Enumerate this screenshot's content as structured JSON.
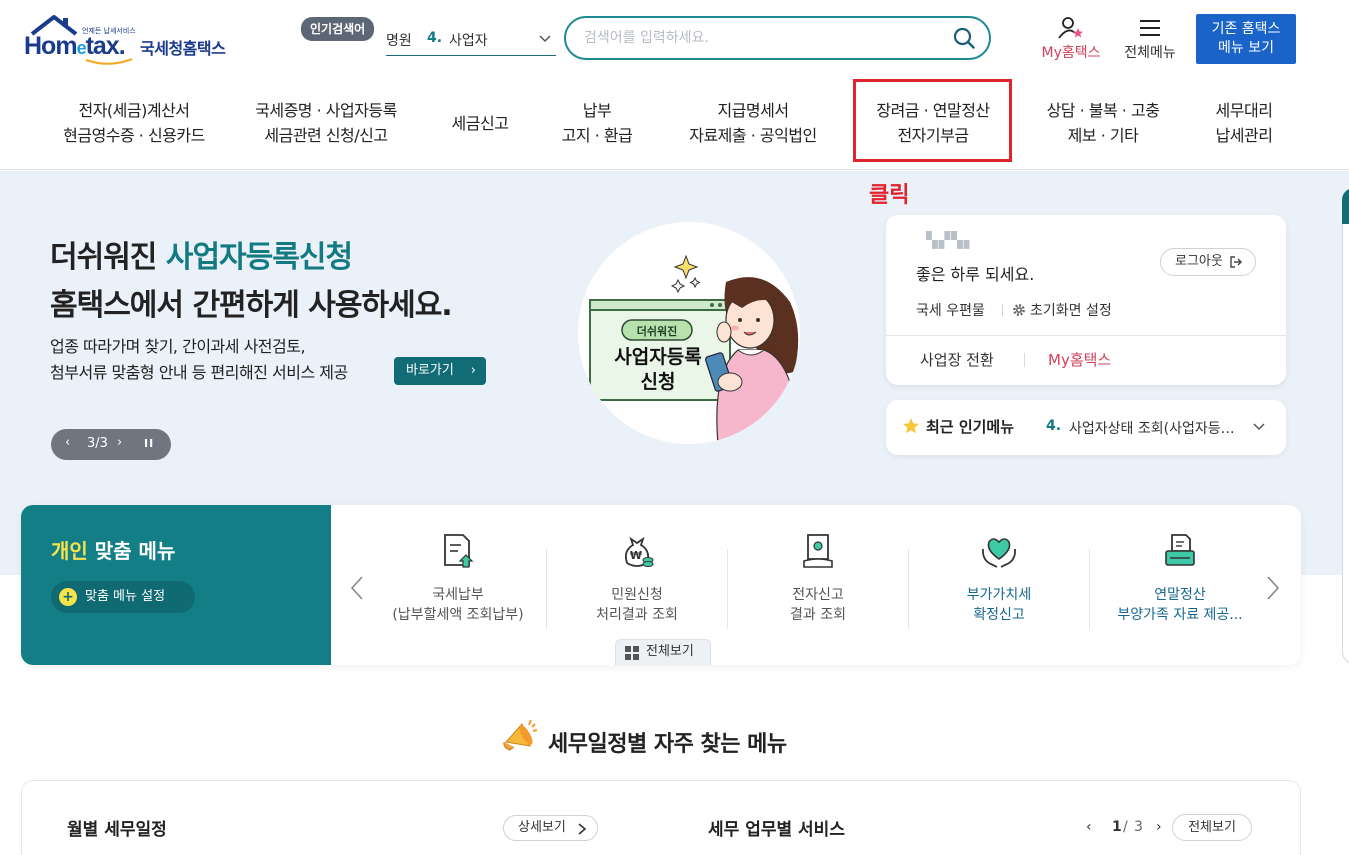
{
  "header": {
    "logo_tagline": "언제든 납세서비스",
    "logo_text": "Hometax.",
    "logo_name": "국세청홈택스",
    "popular_badge": "인기검색어",
    "popular_cut": "명원",
    "popular_rank": "4.",
    "popular_term": "사업자",
    "search_placeholder": "검색어를 입력하세요.",
    "my_hometax": "My홈택스",
    "all_menu": "전체메뉴",
    "old_hometax_line1": "기존 홈택스",
    "old_hometax_line2": "메뉴 보기"
  },
  "nav": {
    "items": [
      {
        "line1": "전자(세금)계산서",
        "line2": "현금영수증 · 신용카드"
      },
      {
        "line1": "국세증명 · 사업자등록",
        "line2": "세금관련 신청/신고"
      },
      {
        "line1": "세금신고",
        "line2": ""
      },
      {
        "line1": "납부",
        "line2": "고지 · 환급"
      },
      {
        "line1": "지급명세서",
        "line2": "자료제출 · 공익법인"
      },
      {
        "line1": "장려금 · 연말정산",
        "line2": "전자기부금"
      },
      {
        "line1": "상담 · 불복 · 고충",
        "line2": "제보 · 기타"
      },
      {
        "line1": "세무대리",
        "line2": "납세관리"
      }
    ],
    "annotation": "클릭"
  },
  "hero": {
    "title_prefix": "더쉬워진 ",
    "title_accent": "사업자등록신청",
    "title_line2": "홈택스에서 간편하게 사용하세요.",
    "desc_line1": "업종 따라가며 찾기, 간이과세 사전검토,",
    "desc_line2": "첨부서류 맞춤형 안내 등 편리해진 서비스 제공",
    "go_button": "바로가기",
    "pager": "3/3",
    "illus_badge": "더쉬워진",
    "illus_line1": "사업자등록",
    "illus_line2": "신청"
  },
  "login": {
    "user_name": "▚▞▚▖",
    "greeting": "좋은 하루 되세요.",
    "logout": "로그아웃",
    "mailbox": "국세 우편물",
    "init_setting": "초기화면 설정",
    "switch_biz": "사업장 전환",
    "my_hometax": "My홈택스"
  },
  "recent": {
    "label": "최근 인기메뉴",
    "rank": "4.",
    "value": "사업자상태 조회(사업자등록번호)"
  },
  "personal": {
    "title_accent": "개인",
    "title_rest": " 맞춤 메뉴",
    "setting": "맞춤 메뉴 설정",
    "items": [
      {
        "line1": "국세납부",
        "line2": "(납부할세액 조회납부)"
      },
      {
        "line1": "민원신청",
        "line2": "처리결과 조회"
      },
      {
        "line1": "전자신고",
        "line2": "결과 조회"
      },
      {
        "line1": "부가가치세",
        "line2": "확정신고"
      },
      {
        "line1": "연말정산",
        "line2": "부양가족 자료 제공..."
      }
    ],
    "view_all": "전체보기"
  },
  "schedule": {
    "title": "세무일정별 자주 찾는 메뉴",
    "monthly": "월별 세무일정",
    "detail": "상세보기",
    "service_title": "세무 업무별 서비스",
    "page_current": "1",
    "page_sep": "/",
    "page_total": "3",
    "view_all": "전체보기"
  }
}
